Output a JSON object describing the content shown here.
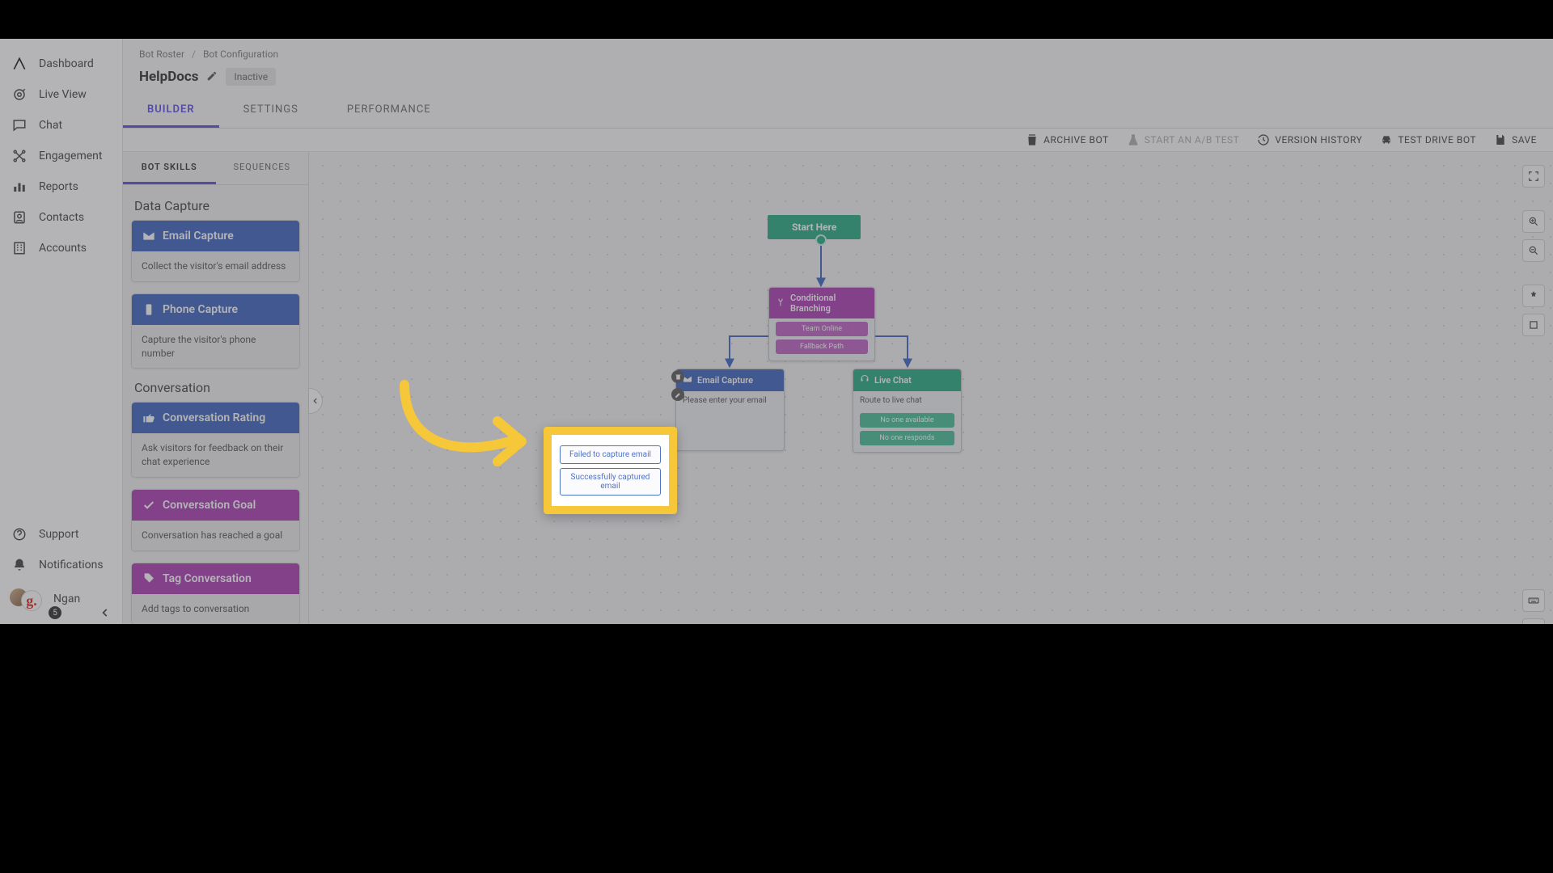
{
  "nav": {
    "items": [
      {
        "name": "dashboard",
        "label": "Dashboard"
      },
      {
        "name": "live-view",
        "label": "Live View"
      },
      {
        "name": "chat",
        "label": "Chat"
      },
      {
        "name": "engagement",
        "label": "Engagement"
      },
      {
        "name": "reports",
        "label": "Reports"
      },
      {
        "name": "contacts",
        "label": "Contacts"
      },
      {
        "name": "accounts",
        "label": "Accounts"
      }
    ],
    "support": "Support",
    "notifications": "Notifications",
    "user": {
      "name": "Ngan",
      "badge": "5",
      "glyph": "g."
    }
  },
  "breadcrumb": {
    "root": "Bot Roster",
    "current": "Bot Configuration"
  },
  "title": "HelpDocs",
  "status": "Inactive",
  "tabs": {
    "builder": "BUILDER",
    "settings": "SETTINGS",
    "performance": "PERFORMANCE"
  },
  "actions": {
    "archive": "ARCHIVE BOT",
    "abtest": "START AN A/B TEST",
    "history": "VERSION HISTORY",
    "testdrive": "TEST DRIVE BOT",
    "save": "SAVE"
  },
  "skills_tabs": {
    "skills": "BOT SKILLS",
    "sequences": "SEQUENCES"
  },
  "skill_groups": {
    "data_capture": {
      "title": "Data Capture",
      "email": {
        "title": "Email Capture",
        "desc": "Collect the visitor's email address"
      },
      "phone": {
        "title": "Phone Capture",
        "desc": "Capture the visitor's phone number"
      }
    },
    "conversation": {
      "title": "Conversation",
      "rating": {
        "title": "Conversation Rating",
        "desc": "Ask visitors for feedback on their chat experience"
      },
      "goal": {
        "title": "Conversation Goal",
        "desc": "Conversation has reached a goal"
      },
      "tag": {
        "title": "Tag Conversation",
        "desc": "Add tags to conversation"
      }
    }
  },
  "flow": {
    "start": "Start Here",
    "branch": {
      "title": "Conditional Branching",
      "opt1": "Team Online",
      "opt2": "Fallback Path"
    },
    "email_node": {
      "title": "Email Capture",
      "prompt": "Please enter your email",
      "fail": "Failed to capture email",
      "success": "Successfully captured email"
    },
    "live_chat": {
      "title": "Live Chat",
      "prompt": "Route to live chat",
      "opt1": "No one available",
      "opt2": "No one responds"
    }
  },
  "colors": {
    "blue": "#4f73c4",
    "purple": "#b24fb8",
    "green": "#3bb28a",
    "highlight": "#f6c738"
  }
}
